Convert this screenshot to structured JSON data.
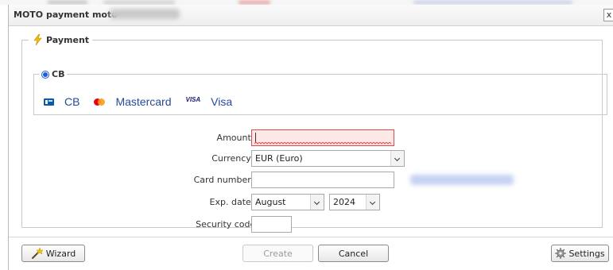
{
  "dialog": {
    "title": "MOTO payment moto",
    "close_label": "x"
  },
  "payment": {
    "legend": "Payment",
    "method": {
      "legend": "CB",
      "brands": [
        {
          "icon": "cb-card-icon",
          "label": "CB"
        },
        {
          "icon": "mastercard-icon",
          "label": "Mastercard"
        },
        {
          "icon": "visa-icon",
          "label": "Visa",
          "icon_text": "VISA"
        }
      ]
    }
  },
  "form": {
    "amount": {
      "label": "Amount",
      "required": "*",
      "suffix": ":",
      "value": ""
    },
    "currency": {
      "label": "Currency",
      "required": "*",
      "suffix": ":",
      "value": "EUR (Euro)"
    },
    "card_number": {
      "label": "Card number",
      "required": "*",
      "suffix": ":",
      "value": ""
    },
    "exp_date": {
      "label": "Exp. date",
      "required": "*",
      "suffix": ":",
      "month": "August",
      "year": "2024"
    },
    "security_code": {
      "label": "Security code:",
      "value": ""
    }
  },
  "footer": {
    "wizard_label": "Wizard",
    "create_label": "Create",
    "cancel_label": "Cancel",
    "settings_label": "Settings"
  },
  "colors": {
    "required": "#d40000",
    "brand_text": "#244a9a",
    "radio": "#1a5fd6",
    "error_bg": "#fde8e8"
  }
}
